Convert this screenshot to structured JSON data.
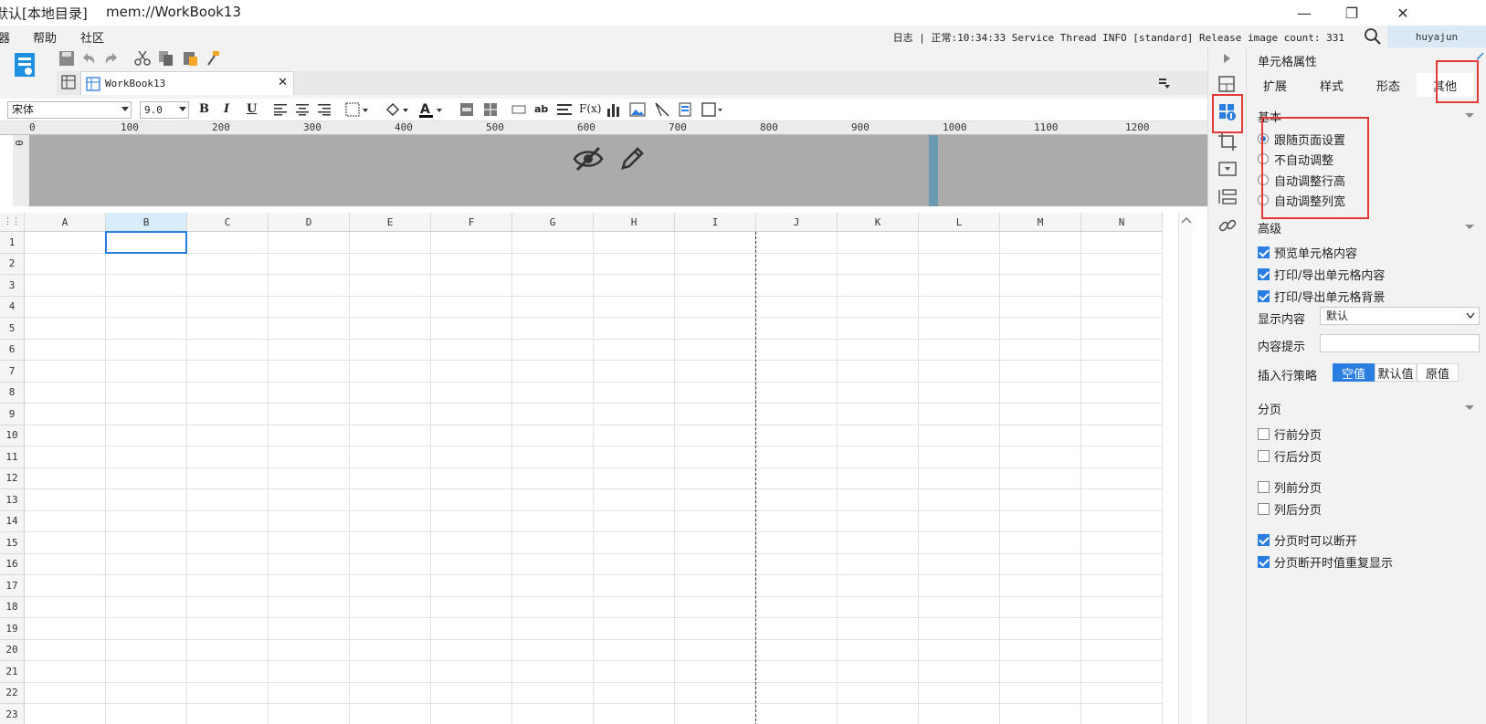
{
  "window": {
    "title_location": "默认[本地目录]",
    "title_file": "mem://WorkBook13",
    "controls": {
      "minimize": "—",
      "restore": "❐",
      "close": "✕"
    }
  },
  "menubar": {
    "items": [
      "器",
      "帮助",
      "社区"
    ],
    "log_text": "日志 | 正常:10:34:33 Service Thread INFO [standard] Release image count: 331",
    "user": "huyajun"
  },
  "tabs": [
    {
      "label": "WorkBook13"
    }
  ],
  "format": {
    "font_family": "宋体",
    "font_size": "9.0",
    "bold": "B",
    "italic": "I",
    "underline": "U"
  },
  "ruler": {
    "ticks": [
      "0",
      "100",
      "200",
      "300",
      "400",
      "500",
      "600",
      "700",
      "800",
      "900",
      "1000",
      "1100",
      "1200"
    ],
    "vertical_zero": "0"
  },
  "grid": {
    "columns": [
      "A",
      "B",
      "C",
      "D",
      "E",
      "F",
      "G",
      "H",
      "I",
      "J",
      "K",
      "L",
      "M",
      "N"
    ],
    "rows": [
      "1",
      "2",
      "3",
      "4",
      "5",
      "6",
      "7",
      "8",
      "9",
      "10",
      "11",
      "12",
      "13",
      "14",
      "15",
      "16",
      "17",
      "18",
      "19",
      "20",
      "21",
      "22",
      "23"
    ],
    "selected_cell": "B1",
    "selected_col": "B"
  },
  "panel": {
    "title": "单元格属性",
    "tabs": [
      "扩展",
      "样式",
      "形态",
      "其他"
    ],
    "active_tab": "其他",
    "basic": {
      "label": "基本",
      "options": [
        "跟随页面设置",
        "不自动调整",
        "自动调整行高",
        "自动调整列宽"
      ],
      "selected": "跟随页面设置"
    },
    "advanced": {
      "label": "高级",
      "checks": [
        {
          "label": "预览单元格内容",
          "checked": true
        },
        {
          "label": "打印/导出单元格内容",
          "checked": true
        },
        {
          "label": "打印/导出单元格背景",
          "checked": true
        }
      ],
      "display_label": "显示内容",
      "display_value": "默认",
      "tip_label": "内容提示",
      "tip_value": "",
      "insert_label": "插入行策略",
      "insert_options": [
        "空值",
        "默认值",
        "原值"
      ],
      "insert_selected": "空值"
    },
    "paging": {
      "label": "分页",
      "checks": [
        {
          "label": "行前分页",
          "checked": false
        },
        {
          "label": "行后分页",
          "checked": false
        },
        {
          "label": "列前分页",
          "checked": false
        },
        {
          "label": "列后分页",
          "checked": false
        },
        {
          "label": "分页时可以断开",
          "checked": true
        },
        {
          "label": "分页断开时值重复显示",
          "checked": true
        }
      ]
    }
  },
  "colors": {
    "accent": "#2a7de1",
    "highlight_red": "#e53935",
    "header_gray": "#ababab"
  }
}
